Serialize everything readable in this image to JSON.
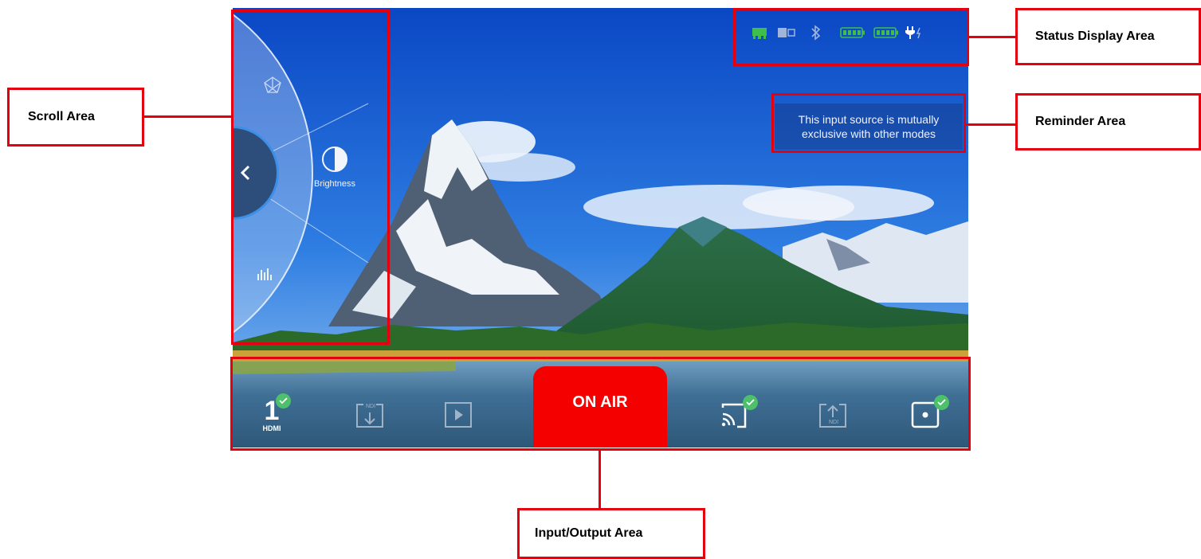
{
  "status_bar": {
    "icons": [
      "ethernet-icon",
      "sd-card-icon",
      "bluetooth-icon",
      "battery-icon",
      "battery-icon",
      "power-plug-icon"
    ],
    "colors": {
      "ethernet": "#3fbe4c",
      "battery": "#3fbe4c",
      "muted": "#9fb6dc"
    }
  },
  "reminder": {
    "text_line1": "This input source is mutually",
    "text_line2": "exclusive with other modes"
  },
  "scroll_wheel": {
    "items": [
      {
        "icon": "projection-icon",
        "label": ""
      },
      {
        "icon": "brightness-icon",
        "label": "Brightness"
      },
      {
        "icon": "audio-levels-icon",
        "label": ""
      }
    ],
    "collapse_button_icon": "chevron-left-icon"
  },
  "io_bar": {
    "hdmi": {
      "number": "1",
      "label": "HDMI",
      "selected": true
    },
    "ndi_in_label": "NDI",
    "ndi_out_label": "NDI",
    "on_air_label": "ON AIR",
    "on_air_color": "#f50000",
    "check_color": "#4cc06a"
  },
  "annotations": {
    "scroll_area": "Scroll Area",
    "status_display_area": "Status Display Area",
    "reminder_area": "Reminder Area",
    "input_output_area": "Input/Output Area"
  },
  "annotation_color": "#e3000f"
}
